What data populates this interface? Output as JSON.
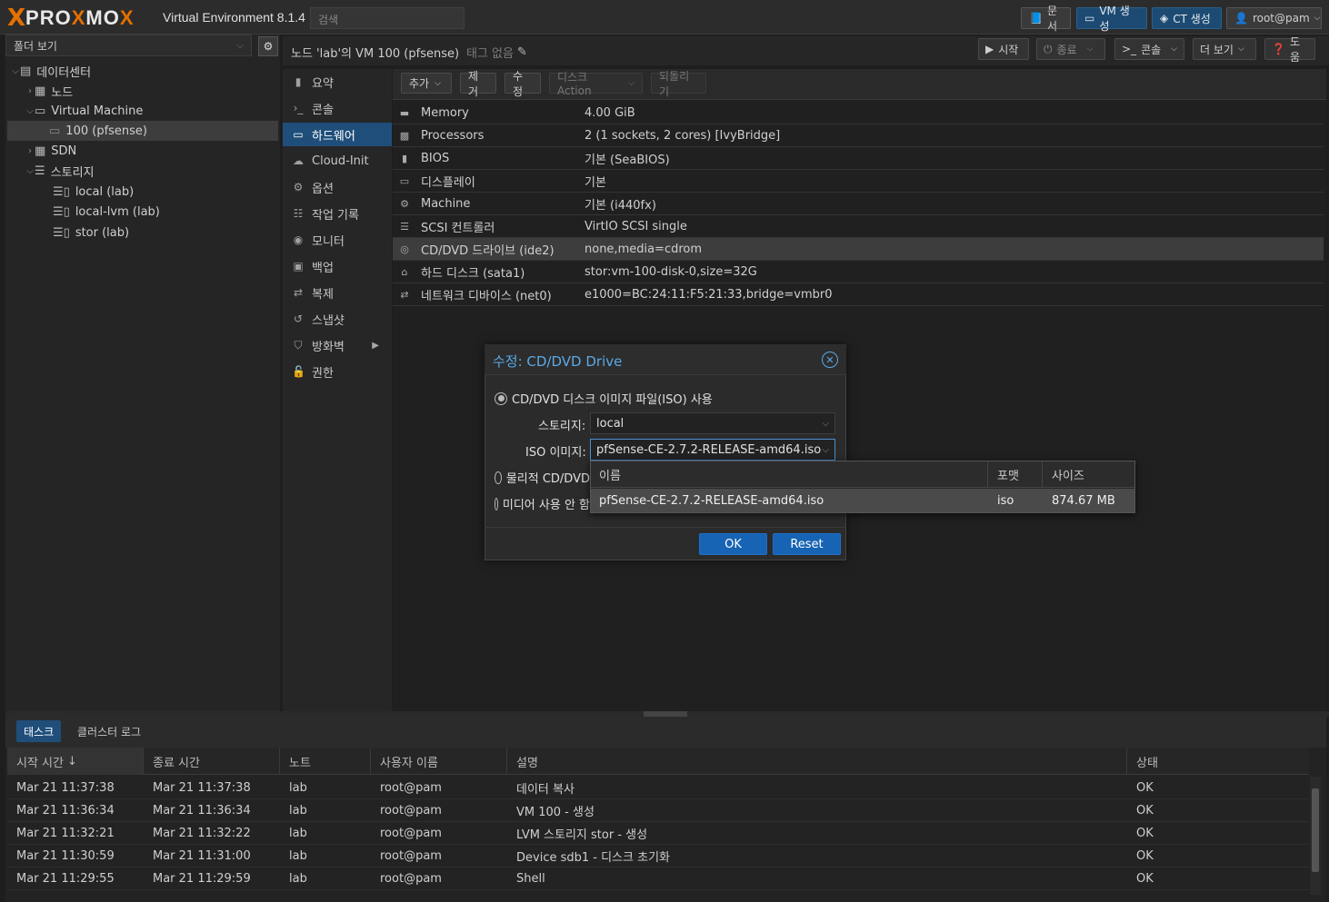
{
  "header": {
    "brand_x": "X",
    "brand_text_1": "PRO",
    "brand_text_x": "X",
    "brand_text_2": "MO",
    "brand_text_x2": "X",
    "product": "Virtual Environment 8.1.4",
    "search_placeholder": "검색",
    "docs": "문서",
    "create_vm": "VM 생성",
    "create_ct": "CT 생성",
    "user": "root@pam"
  },
  "tree": {
    "view": "폴더 보기",
    "items": [
      {
        "label": "데이터센터"
      },
      {
        "label": "노드"
      },
      {
        "label": "Virtual Machine"
      },
      {
        "label": "100 (pfsense)"
      },
      {
        "label": "SDN"
      },
      {
        "label": "스토리지"
      },
      {
        "label": "local (lab)"
      },
      {
        "label": "local-lvm (lab)"
      },
      {
        "label": "stor (lab)"
      }
    ]
  },
  "content": {
    "title": "노드 'lab'의 VM 100 (pfsense)",
    "tags": "태그 없음",
    "start": "시작",
    "shutdown": "종료",
    "console": "콘솔",
    "more": "더 보기",
    "help": "도움"
  },
  "vmnav": [
    {
      "label": "요약"
    },
    {
      "label": "콘솔"
    },
    {
      "label": "하드웨어"
    },
    {
      "label": "Cloud-Init"
    },
    {
      "label": "옵션"
    },
    {
      "label": "작업 기록"
    },
    {
      "label": "모니터"
    },
    {
      "label": "백업"
    },
    {
      "label": "복제"
    },
    {
      "label": "스냅샷"
    },
    {
      "label": "방화벽"
    },
    {
      "label": "권한"
    }
  ],
  "hw_toolbar": {
    "add": "추가",
    "remove": "제거",
    "edit": "수정",
    "disk_action": "디스크 Action",
    "revert": "되돌리기"
  },
  "hardware": [
    {
      "name": "Memory",
      "value": "4.00 GiB"
    },
    {
      "name": "Processors",
      "value": "2 (1 sockets, 2 cores) [IvyBridge]"
    },
    {
      "name": "BIOS",
      "value": "기본 (SeaBIOS)"
    },
    {
      "name": "디스플레이",
      "value": "기본"
    },
    {
      "name": "Machine",
      "value": "기본 (i440fx)"
    },
    {
      "name": "SCSI 컨트롤러",
      "value": "VirtIO SCSI single"
    },
    {
      "name": "CD/DVD 드라이브 (ide2)",
      "value": "none,media=cdrom"
    },
    {
      "name": "하드 디스크 (sata1)",
      "value": "stor:vm-100-disk-0,size=32G"
    },
    {
      "name": "네트워크 디바이스 (net0)",
      "value": "e1000=BC:24:11:F5:21:33,bridge=vmbr0"
    }
  ],
  "modal": {
    "title": "수정: CD/DVD Drive",
    "opt_iso": "CD/DVD 디스크 이미지 파일(ISO) 사용",
    "storage_label": "스토리지:",
    "storage_value": "local",
    "iso_label": "ISO 이미지:",
    "iso_value": "pfSense-CE-2.7.2-RELEASE-amd64.iso",
    "opt_physical": "물리적 CD/DVD",
    "opt_none": "미디어 사용 안 함",
    "ok": "OK",
    "reset": "Reset"
  },
  "dropdown": {
    "col_name": "이름",
    "col_format": "포맷",
    "col_size": "사이즈",
    "row_name": "pfSense-CE-2.7.2-RELEASE-amd64.iso",
    "row_format": "iso",
    "row_size": "874.67 MB"
  },
  "tasks": {
    "tab_tasks": "태스크",
    "tab_cluster": "클러스터 로그",
    "columns": [
      "시작 시간",
      "종료 시간",
      "노트",
      "사용자 이름",
      "설명",
      "상태"
    ],
    "rows": [
      [
        "Mar 21 11:37:38",
        "Mar 21 11:37:38",
        "lab",
        "root@pam",
        "데이터 복사",
        "OK"
      ],
      [
        "Mar 21 11:36:34",
        "Mar 21 11:36:34",
        "lab",
        "root@pam",
        "VM 100 - 생성",
        "OK"
      ],
      [
        "Mar 21 11:32:21",
        "Mar 21 11:32:22",
        "lab",
        "root@pam",
        "LVM 스토리지 stor - 생성",
        "OK"
      ],
      [
        "Mar 21 11:30:59",
        "Mar 21 11:31:00",
        "lab",
        "root@pam",
        "Device sdb1 - 디스크 초기화",
        "OK"
      ],
      [
        "Mar 21 11:29:55",
        "Mar 21 11:29:59",
        "lab",
        "root@pam",
        "Shell",
        "OK"
      ]
    ]
  }
}
